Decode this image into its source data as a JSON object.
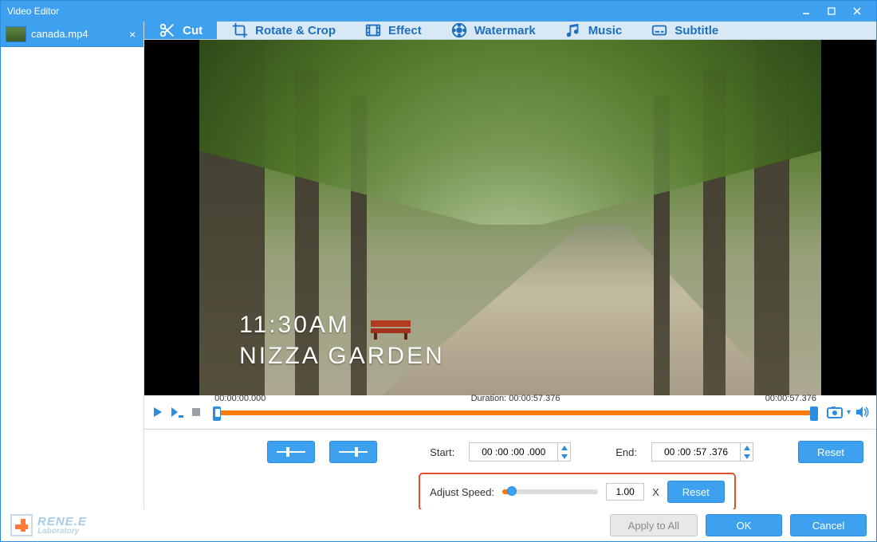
{
  "window": {
    "title": "Video Editor"
  },
  "file": {
    "name": "canada.mp4"
  },
  "tabs": {
    "cut": "Cut",
    "rotate": "Rotate & Crop",
    "effect": "Effect",
    "watermark": "Watermark",
    "music": "Music",
    "subtitle": "Subtitle"
  },
  "overlay": {
    "line1": "11:30AM",
    "line2": "NIZZA GARDEN"
  },
  "timeline": {
    "current": "00:00:00.000",
    "duration_label": "Duration: 00:00:57.376",
    "end": "00:00:57.376"
  },
  "controls": {
    "start_label": "Start:",
    "start_value": "00 :00 :00 .000",
    "end_label": "End:",
    "end_value": "00 :00 :57 .376",
    "reset": "Reset",
    "speed_label": "Adjust Speed:",
    "speed_value": "1.00",
    "speed_suffix": "X",
    "speed_reset": "Reset"
  },
  "footer": {
    "apply_all": "Apply to All",
    "ok": "OK",
    "cancel": "Cancel",
    "logo1": "RENE.E",
    "logo2": "Laboratory"
  }
}
